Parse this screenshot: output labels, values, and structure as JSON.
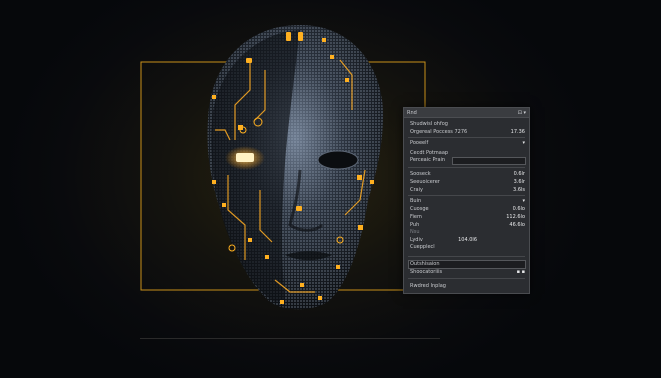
{
  "panel": {
    "title": "Rnd",
    "header_icons": "⊡ ▾",
    "rows": [
      {
        "label": "Shudwisl ohfog",
        "value": ""
      },
      {
        "label": "Orgereal Poccess 7276",
        "value": "17.36"
      },
      {
        "label": "Pooeelf",
        "value": "▾"
      },
      {
        "label": "Cecdt Potmaap",
        "value": ""
      },
      {
        "label": "Perceaic Prain",
        "value": ""
      },
      {
        "label": "Sooseck",
        "value": "0.6lr"
      },
      {
        "label": "Seeuoicerer",
        "value": "3.6lr"
      },
      {
        "label": "Craiy",
        "value": "3.6ls"
      },
      {
        "label": "Buin",
        "value": "▾"
      },
      {
        "label": "Cuosge",
        "value": "0.6lo"
      },
      {
        "label": "Fiem",
        "value": "112.6lo"
      },
      {
        "label": "Puh",
        "value": "46.6lo"
      },
      {
        "label": "Nsu",
        "value": ""
      },
      {
        "label": "Lydiv",
        "value": "104.0l6"
      },
      {
        "label": "Cuepplecl",
        "value": ""
      },
      {
        "label": "Outshisaion",
        "value": ""
      },
      {
        "label": "Shoocatoriiis",
        "value": "▪ ▪"
      },
      {
        "label": "Rwdred Inplag",
        "value": ""
      }
    ]
  },
  "colors": {
    "accent": "#f5a623",
    "panel_bg": "#2b2d31",
    "background": "#07090c"
  }
}
